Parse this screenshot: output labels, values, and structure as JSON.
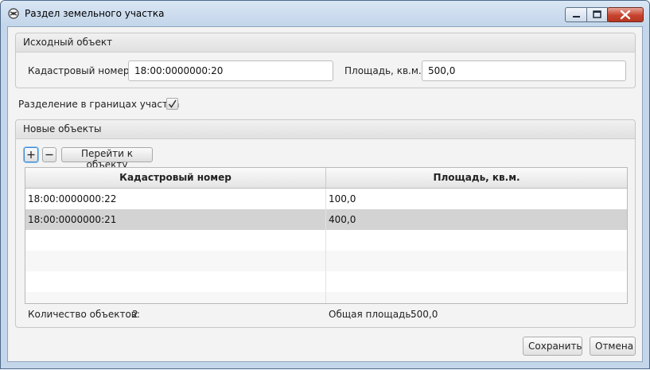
{
  "window": {
    "title": "Раздел земельного участка",
    "controls": {
      "minimize": "minimize-icon",
      "maximize": "maximize-icon",
      "close": "close-icon"
    }
  },
  "source_panel": {
    "title": "Исходный объект",
    "cadastral_label": "Кадастровый номер",
    "cadastral_value": "18:00:0000000:20",
    "area_label": "Площадь, кв.м.",
    "area_value": "500,0"
  },
  "split_within_bounds": {
    "label": "Разделение в границах участка",
    "checked": true
  },
  "new_objects_panel": {
    "title": "Новые объекты",
    "toolbar": {
      "add_icon": "plus-icon",
      "remove_icon": "minus-icon",
      "goto_label": "Перейти к объекту"
    },
    "table": {
      "columns": [
        "Кадастровый номер",
        "Площадь, кв.м."
      ],
      "rows": [
        [
          "18:00:0000000:22",
          "100,0"
        ],
        [
          "18:00:0000000:21",
          "400,0"
        ]
      ],
      "selected_row": 1
    },
    "count_label": "Количество объектов:",
    "count_value": "2",
    "total_area_label": "Общая площадь:",
    "total_area_value": "500,0"
  },
  "footer": {
    "save_label": "Сохранить",
    "cancel_label": "Отмена"
  }
}
